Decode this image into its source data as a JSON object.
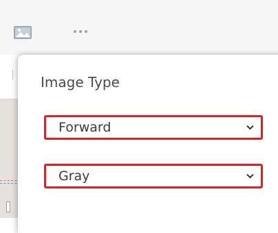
{
  "toolbar": {
    "icons": [
      "image-icon",
      "more-dots-icon"
    ]
  },
  "panel": {
    "title": "Image Type",
    "selects": [
      {
        "value": "Forward",
        "icon": "chevron-down-icon"
      },
      {
        "value": "Gray",
        "icon": "chevron-down-icon"
      }
    ]
  },
  "colors": {
    "highlight_border": "#e02020",
    "toolbar_bg": "#f6f6f6",
    "text": "#3a3a3a"
  }
}
